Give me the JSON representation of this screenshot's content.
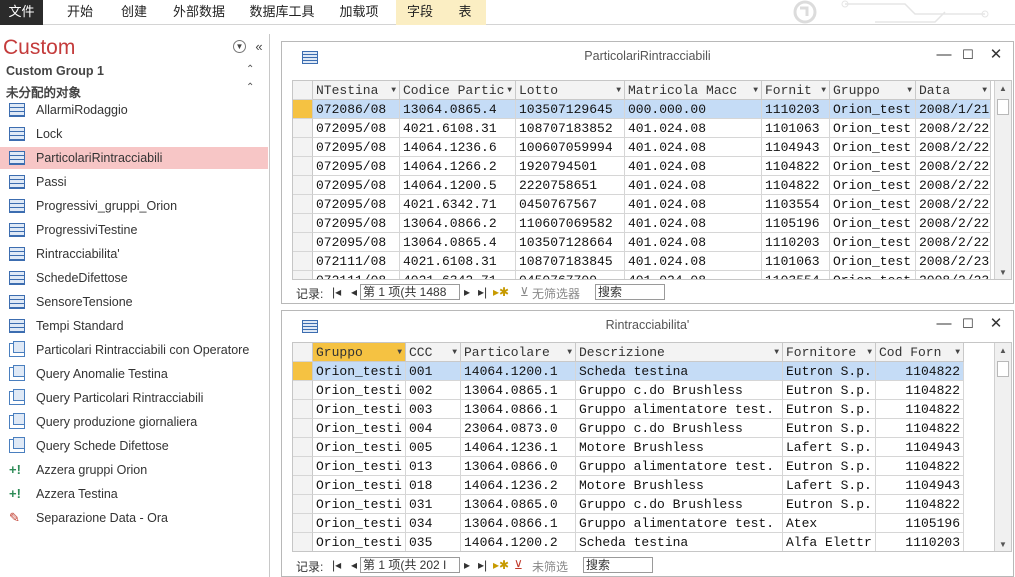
{
  "ribbon": {
    "tabs": [
      "文件",
      "开始",
      "创建",
      "外部数据",
      "数据库工具",
      "加载项",
      "字段",
      "表"
    ]
  },
  "nav": {
    "title": "Custom",
    "group1": "Custom Group 1",
    "group2": "未分配的对象",
    "items": [
      {
        "label": "AllarmiRodaggio",
        "icon": "table"
      },
      {
        "label": "Lock",
        "icon": "table"
      },
      {
        "label": "ParticolariRintracciabili",
        "icon": "table"
      },
      {
        "label": "Passi",
        "icon": "table"
      },
      {
        "label": "Progressivi_gruppi_Orion",
        "icon": "table"
      },
      {
        "label": "ProgressiviTestine",
        "icon": "table"
      },
      {
        "label": "Rintracciabilita'",
        "icon": "table"
      },
      {
        "label": "SchedeDifettose",
        "icon": "table"
      },
      {
        "label": "SensoreTensione",
        "icon": "table"
      },
      {
        "label": "Tempi Standard",
        "icon": "table"
      },
      {
        "label": "Particolari Rintracciabili con Operatore",
        "icon": "query"
      },
      {
        "label": "Query Anomalie Testina",
        "icon": "query"
      },
      {
        "label": "Query Particolari Rintracciabili",
        "icon": "query"
      },
      {
        "label": "Query produzione giornaliera",
        "icon": "query"
      },
      {
        "label": "Query Schede Difettose",
        "icon": "query"
      },
      {
        "label": "Azzera gruppi Orion",
        "icon": "action"
      },
      {
        "label": "Azzera Testina",
        "icon": "action"
      },
      {
        "label": "Separazione Data - Ora",
        "icon": "macro"
      }
    ]
  },
  "win1": {
    "title": "ParticolariRintracciabili",
    "headers": [
      "NTestina",
      "Codice Partic",
      "Lotto",
      "Matricola Macc",
      "Fornit",
      "Gruppo",
      "Data"
    ],
    "rows": [
      [
        "072086/08",
        "13064.0865.4",
        "103507129645",
        "000.000.00",
        "1110203",
        "Orion_test",
        "2008/1/21"
      ],
      [
        "072095/08",
        "4021.6108.31",
        "108707183852",
        "401.024.08",
        "1101063",
        "Orion_test",
        "2008/2/22"
      ],
      [
        "072095/08",
        "14064.1236.6",
        "100607059994",
        "401.024.08",
        "1104943",
        "Orion_test",
        "2008/2/22"
      ],
      [
        "072095/08",
        "14064.1266.2",
        "1920794501",
        "401.024.08",
        "1104822",
        "Orion_test",
        "2008/2/22"
      ],
      [
        "072095/08",
        "14064.1200.5",
        "2220758651",
        "401.024.08",
        "1104822",
        "Orion_test",
        "2008/2/22"
      ],
      [
        "072095/08",
        "4021.6342.71",
        "0450767567",
        "401.024.08",
        "1103554",
        "Orion_test",
        "2008/2/22"
      ],
      [
        "072095/08",
        "13064.0866.2",
        "110607069582",
        "401.024.08",
        "1105196",
        "Orion_test",
        "2008/2/22"
      ],
      [
        "072095/08",
        "13064.0865.4",
        "103507128664",
        "401.024.08",
        "1110203",
        "Orion_test",
        "2008/2/22"
      ],
      [
        "072111/08",
        "4021.6108.31",
        "108707183845",
        "401.024.08",
        "1101063",
        "Orion_test",
        "2008/2/23"
      ],
      [
        "072111/08",
        "4021.6342.71",
        "0450767709",
        "401.024.08",
        "1103554",
        "Orion_test",
        "2008/2/23"
      ]
    ],
    "record_label": "记录:",
    "record_value": "第 1 项(共 1488",
    "filter": "无筛选器",
    "search": "搜索"
  },
  "win2": {
    "title": "Rintracciabilita'",
    "headers": [
      "Gruppo",
      "CCC",
      "Particolare",
      "Descrizione",
      "Fornitore",
      "Cod Forn"
    ],
    "rows": [
      [
        "Orion_testi",
        "001",
        "14064.1200.1",
        "Scheda testina",
        "Eutron S.p.",
        "1104822"
      ],
      [
        "Orion_testi",
        "002",
        "13064.0865.1",
        "Gruppo c.do Brushless",
        "Eutron S.p.",
        "1104822"
      ],
      [
        "Orion_testi",
        "003",
        "13064.0866.1",
        "Gruppo alimentatore test.",
        "Eutron S.p.",
        "1104822"
      ],
      [
        "Orion_testi",
        "004",
        "23064.0873.0",
        "Gruppo c.do Brushless",
        "Eutron S.p.",
        "1104822"
      ],
      [
        "Orion_testi",
        "005",
        "14064.1236.1",
        "Motore Brushless",
        "Lafert S.p.",
        "1104943"
      ],
      [
        "Orion_testi",
        "013",
        "13064.0866.0",
        "Gruppo alimentatore test.",
        "Eutron S.p.",
        "1104822"
      ],
      [
        "Orion_testi",
        "018",
        "14064.1236.2",
        "Motore Brushless",
        "Lafert S.p.",
        "1104943"
      ],
      [
        "Orion_testi",
        "031",
        "13064.0865.0",
        "Gruppo c.do Brushless",
        "Eutron S.p.",
        "1104822"
      ],
      [
        "Orion_testi",
        "034",
        "13064.0866.1",
        "Gruppo alimentatore test.",
        "Atex",
        "1105196"
      ],
      [
        "Orion_testi",
        "035",
        "14064.1200.2",
        "Scheda testina",
        "Alfa Elettr",
        "1110203"
      ]
    ],
    "record_label": "记录:",
    "record_value": "第 1 项(共 202 I",
    "filter": "未筛选",
    "search": "搜索"
  },
  "colors": {
    "selected_nav": "#f7c6c6",
    "current_row": "#c5dcf6",
    "active_header": "#f5c242",
    "title_red": "#c43b3b"
  }
}
